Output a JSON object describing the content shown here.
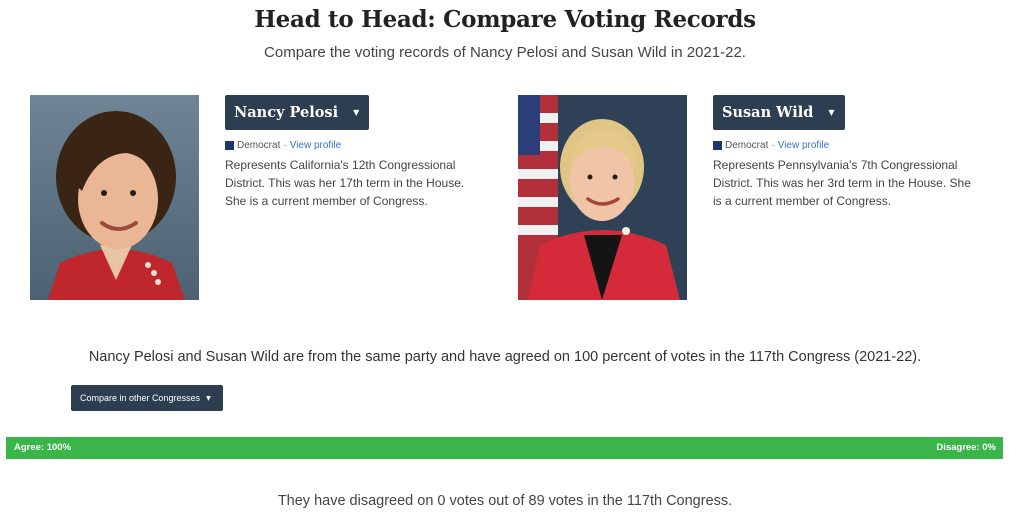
{
  "page": {
    "title": "Head to Head: Compare Voting Records",
    "subtitle": "Compare the voting records of Nancy Pelosi and Susan Wild in 2021-22."
  },
  "members": [
    {
      "name": "Nancy Pelosi",
      "party": "Democrat",
      "party_color": "#1b3a6b",
      "separator": "·",
      "profile_link": "View profile",
      "description": "Represents California's 12th Congressional District. This was her 17th term in the House. She is a current member of Congress."
    },
    {
      "name": "Susan Wild",
      "party": "Democrat",
      "party_color": "#1b3a6b",
      "separator": "·",
      "profile_link": "View profile",
      "description": "Represents Pennsylvania's 7th Congressional District. This was her 3rd term in the House. She is a current member of Congress."
    }
  ],
  "summary": "Nancy Pelosi and Susan Wild are from the same party and have agreed on 100 percent of votes in the 117th Congress (2021-22).",
  "compare_button": "Compare in other Congresses",
  "caret_icon": "▼",
  "agreement_bar": {
    "agree_label": "Agree: 100%",
    "disagree_label": "Disagree: 0%",
    "agree_percent": 100,
    "agree_color": "#39b54a"
  },
  "footer": "They have disagreed on 0 votes out of 89 votes in the 117th Congress.",
  "colors": {
    "button_bg": "#2c3e50",
    "link": "#3b74c7"
  }
}
